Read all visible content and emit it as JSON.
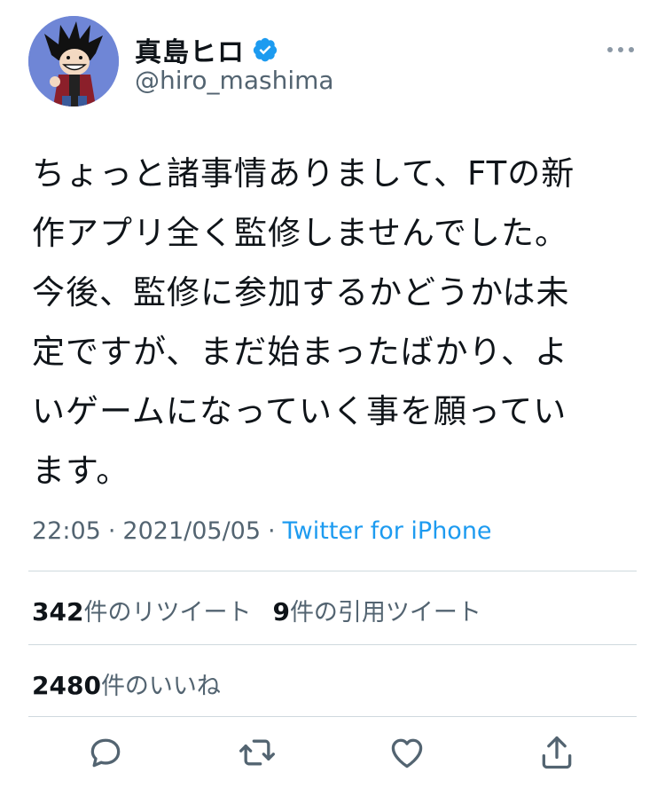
{
  "author": {
    "display_name": "真島ヒロ",
    "handle": "@hiro_mashima",
    "avatar_icon": "avatar-image",
    "verified_icon": "verified-badge-icon",
    "verified_color": "#1d9bf0"
  },
  "tweet": {
    "text": "ちょっと諸事情ありまして、FTの新\n作アプリ全く監修しませんでした。\n今後、監修に参加するかどうかは未\n定ですが、まだ始まったばかり、よ\nいゲームになっていく事を願ってい\nます。",
    "time": "22:05",
    "date": "2021/05/05",
    "separator": "·",
    "source": "Twitter for iPhone"
  },
  "stats": {
    "retweets_count": "342",
    "retweets_label": "件のリツイート",
    "quotes_count": "9",
    "quotes_label": "件の引用ツイート",
    "likes_count": "2480",
    "likes_label": "件のいいね"
  },
  "actions": {
    "reply_icon": "reply-icon",
    "retweet_icon": "retweet-icon",
    "like_icon": "heart-icon",
    "share_icon": "share-icon",
    "more_icon": "more-options-icon"
  },
  "colors": {
    "text_primary": "#0f1419",
    "text_secondary": "#536471",
    "link": "#1d9bf0",
    "divider": "#cfd9de",
    "icon": "#536471"
  }
}
